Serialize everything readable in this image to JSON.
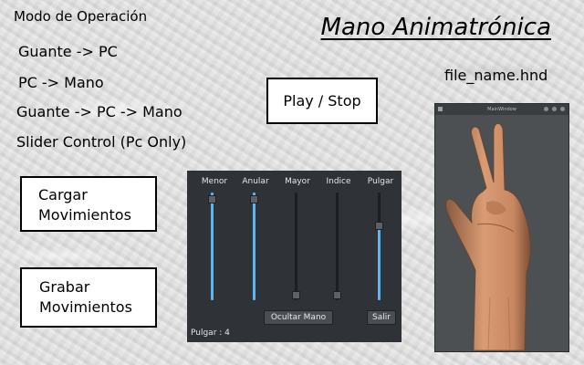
{
  "mode": {
    "title": "Modo de Operación",
    "items": [
      {
        "label": "Guante -> PC"
      },
      {
        "label": "PC -> Mano"
      },
      {
        "label": "Guante -> PC -> Mano"
      },
      {
        "label": "Slider Control (Pc Only)"
      }
    ]
  },
  "app_title": "Mano Animatrónica",
  "file_name": "file_name.hnd",
  "buttons": {
    "play_stop": "Play / Stop",
    "cargar_line1": "Cargar",
    "cargar_line2": "Movimientos",
    "grabar_line1": "Grabar",
    "grabar_line2": "Movimientos"
  },
  "slider_window": {
    "fingers": [
      {
        "label": "Menor",
        "level": 0.0
      },
      {
        "label": "Anular",
        "level": 0.0
      },
      {
        "label": "Mayor",
        "level": 1.0
      },
      {
        "label": "Indice",
        "level": 1.0
      },
      {
        "label": "Pulgar",
        "level": 0.3
      }
    ],
    "hide_button": "Ocultar Mano",
    "exit_button": "Salir",
    "status": "Pulgar : 4",
    "fill_color": "#5fb5f2"
  },
  "hand_window": {
    "title": "MainWindow",
    "icon": "app-icon",
    "controls": [
      "minimize-icon",
      "maximize-icon",
      "close-icon"
    ]
  }
}
